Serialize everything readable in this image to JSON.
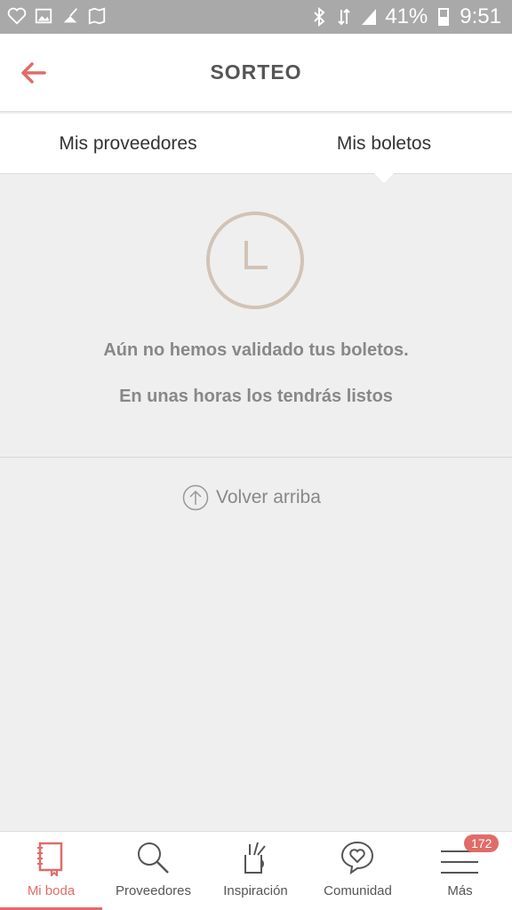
{
  "status_bar": {
    "battery": "41%",
    "time": "9:51"
  },
  "header": {
    "title": "SORTEO"
  },
  "tabs": [
    {
      "label": "Mis proveedores"
    },
    {
      "label": "Mis boletos"
    }
  ],
  "empty_state": {
    "line1": "Aún no hemos validado tus boletos.",
    "line2": "En unas horas los tendrás listos"
  },
  "back_to_top": "Volver arriba",
  "bottom_nav": [
    {
      "label": "Mi boda",
      "icon": "notebook-icon",
      "active": true
    },
    {
      "label": "Proveedores",
      "icon": "search-icon"
    },
    {
      "label": "Inspiración",
      "icon": "pencil-cup-icon"
    },
    {
      "label": "Comunidad",
      "icon": "chat-heart-icon"
    },
    {
      "label": "Más",
      "icon": "menu-icon",
      "badge": "172"
    }
  ],
  "colors": {
    "accent": "#e06c68",
    "clock": "#d2c3b6",
    "text_muted": "#888888",
    "status_bar": "#a9a9a9"
  }
}
